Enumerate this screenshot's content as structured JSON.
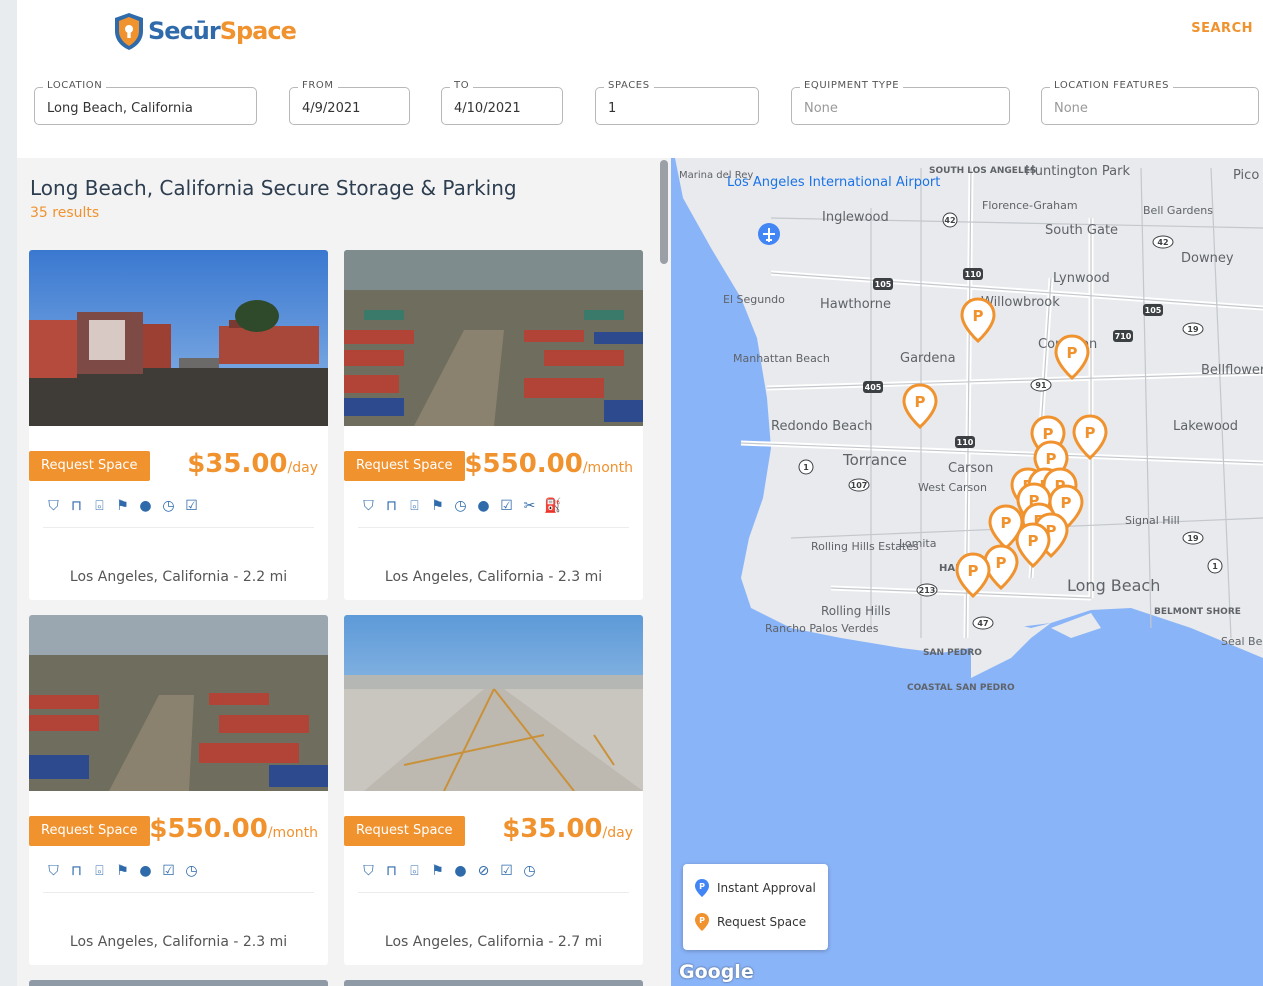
{
  "header": {
    "logo_part1": "Secūr",
    "logo_part2": "Space",
    "search_label": "SEARCH"
  },
  "filters": {
    "location": {
      "label": "LOCATION",
      "value": "Long Beach, California"
    },
    "from": {
      "label": "FROM",
      "value": "4/9/2021"
    },
    "to": {
      "label": "TO",
      "value": "4/10/2021"
    },
    "spaces": {
      "label": "SPACES",
      "value": "1"
    },
    "equipment_type": {
      "label": "EQUIPMENT TYPE",
      "value": "None"
    },
    "location_features": {
      "label": "LOCATION FEATURES",
      "value": "None"
    }
  },
  "results": {
    "title": "Long Beach, California Secure Storage & Parking",
    "count": "35 results",
    "cards": [
      {
        "button": "Request Space",
        "price": "$35.00",
        "unit": "/day",
        "location": "Los Angeles, California - 2.2 mi"
      },
      {
        "button": "Request Space",
        "price": "$550.00",
        "unit": "/month",
        "location": "Los Angeles, California - 2.3 mi"
      },
      {
        "button": "Request Space",
        "price": "$550.00",
        "unit": "/month",
        "location": "Los Angeles, California - 2.3 mi"
      },
      {
        "button": "Request Space",
        "price": "$35.00",
        "unit": "/day",
        "location": "Los Angeles, California - 2.7 mi"
      }
    ]
  },
  "map": {
    "labels": {
      "marina": "Marina del Rey",
      "lax": "Los Angeles International Airport",
      "inglewood": "Inglewood",
      "huntington": "Huntington Park",
      "pico": "Pico",
      "florence": "Florence-Graham",
      "bell": "Bell Gardens",
      "southgate": "South Gate",
      "downey": "Downey",
      "lynwood": "Lynwood",
      "elsegundo": "El Segundo",
      "hawthorne": "Hawthorne",
      "willowbrook": "Willowbrook",
      "compton": "Compton",
      "manhattan": "Manhattan Beach",
      "gardena": "Gardena",
      "bellflower": "Bellflower",
      "redondo": "Redondo Beach",
      "lakewood": "Lakewood",
      "torrance": "Torrance",
      "carson": "Carson",
      "westcarson": "West Carson",
      "signalhill": "Signal Hill",
      "rolling": "Rolling Hills Estates",
      "lomita": "Lomita",
      "longbeach": "Long Beach",
      "rollinghills": "Rolling Hills",
      "rancho": "Rancho Palos Verdes",
      "belmont": "BELMONT SHORE",
      "sealbeach": "Seal Be",
      "sanpedro": "SAN PEDRO",
      "coastal": "COASTAL SAN PEDRO",
      "south_la": "SOUTH LOS ANGELES",
      "harbor": "HAR"
    },
    "highway_shields": [
      "42",
      "105",
      "110",
      "105",
      "710",
      "91",
      "405",
      "110",
      "1",
      "107",
      "213",
      "47",
      "19",
      "19",
      "1",
      "42",
      "405"
    ],
    "legend": {
      "instant": "Instant Approval",
      "request": "Request Space"
    },
    "attribution": "Google",
    "colors": {
      "water": "#8ab4f8",
      "request_pin": "#f0922e",
      "instant_pin": "#4285f4"
    }
  }
}
